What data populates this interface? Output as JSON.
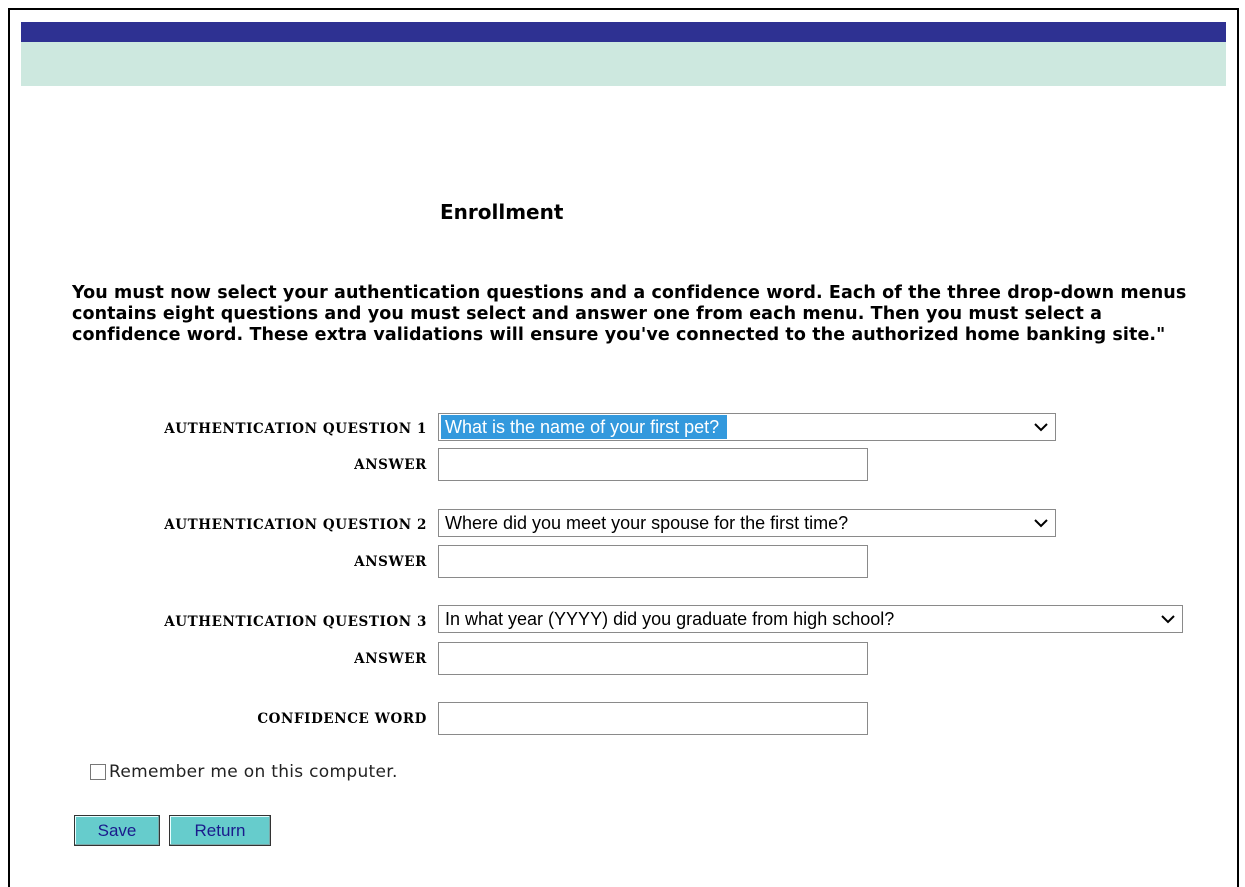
{
  "colors": {
    "header_dark": "#2e3192",
    "header_light": "#cde8df",
    "button_bg": "#66cccc",
    "button_text": "#1a1a8c",
    "select_highlight": "#3399dd"
  },
  "page": {
    "title": "Enrollment",
    "intro": "You must now select your authentication questions and a confidence word. Each of the three drop-down menus contains eight questions and you must select and answer one from each menu. Then you must select a confidence word. These extra validations will ensure you've connected to the authorized home banking site.\""
  },
  "questions": [
    {
      "label": "AUTHENTICATION QUESTION 1",
      "selected": "What is the name of your first pet?",
      "answer_label": "ANSWER",
      "answer_value": ""
    },
    {
      "label": "AUTHENTICATION QUESTION 2",
      "selected": "Where did you meet your spouse for the first time?",
      "answer_label": "ANSWER",
      "answer_value": ""
    },
    {
      "label": "AUTHENTICATION QUESTION 3",
      "selected": "In what year (YYYY) did you graduate from high school?",
      "answer_label": "ANSWER",
      "answer_value": ""
    }
  ],
  "confidence": {
    "label": "CONFIDENCE WORD",
    "value": ""
  },
  "remember": {
    "label": "Remember me on this computer.",
    "checked": false
  },
  "buttons": {
    "save": "Save",
    "return": "Return"
  },
  "icons": {
    "dropdown": "chevron-down-icon",
    "checkbox": "checkbox-icon"
  }
}
